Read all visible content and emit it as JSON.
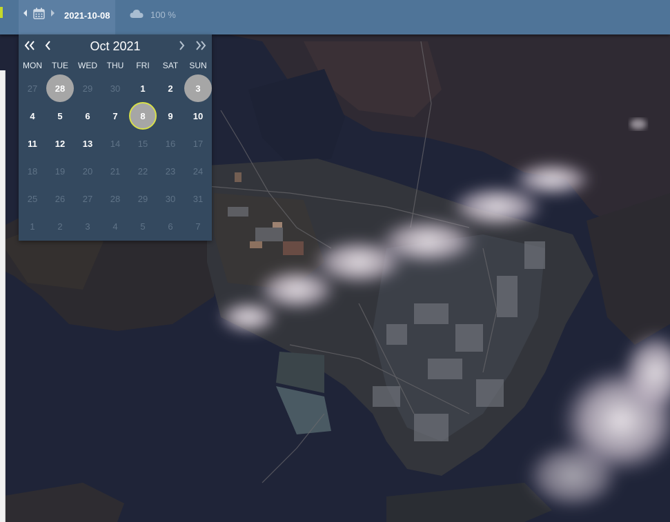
{
  "toolbar": {
    "prev_icon": "caret-left-icon",
    "calendar_icon": "calendar-icon",
    "next_icon": "caret-right-icon",
    "date": "2021-10-08",
    "cloud_icon": "cloud-icon",
    "cloud_coverage": "100 %"
  },
  "calendar": {
    "title": "Oct 2021",
    "nav": {
      "prev_year": "«",
      "prev_month": "‹",
      "next_month": "›",
      "next_year": "»"
    },
    "weekdays": [
      "MON",
      "TUE",
      "WED",
      "THU",
      "FRI",
      "SAT",
      "SUN"
    ],
    "weeks": [
      [
        {
          "d": "27",
          "s": "out"
        },
        {
          "d": "28",
          "s": "avail"
        },
        {
          "d": "29",
          "s": "out"
        },
        {
          "d": "30",
          "s": "out"
        },
        {
          "d": "1",
          "s": "in"
        },
        {
          "d": "2",
          "s": "in"
        },
        {
          "d": "3",
          "s": "avail"
        }
      ],
      [
        {
          "d": "4",
          "s": "in"
        },
        {
          "d": "5",
          "s": "in"
        },
        {
          "d": "6",
          "s": "in"
        },
        {
          "d": "7",
          "s": "in"
        },
        {
          "d": "8",
          "s": "selected"
        },
        {
          "d": "9",
          "s": "in"
        },
        {
          "d": "10",
          "s": "in"
        }
      ],
      [
        {
          "d": "11",
          "s": "in"
        },
        {
          "d": "12",
          "s": "in"
        },
        {
          "d": "13",
          "s": "in"
        },
        {
          "d": "14",
          "s": "dis"
        },
        {
          "d": "15",
          "s": "dis"
        },
        {
          "d": "16",
          "s": "dis"
        },
        {
          "d": "17",
          "s": "dis"
        }
      ],
      [
        {
          "d": "18",
          "s": "dis"
        },
        {
          "d": "19",
          "s": "dis"
        },
        {
          "d": "20",
          "s": "dis"
        },
        {
          "d": "21",
          "s": "dis"
        },
        {
          "d": "22",
          "s": "dis"
        },
        {
          "d": "23",
          "s": "dis"
        },
        {
          "d": "24",
          "s": "dis"
        }
      ],
      [
        {
          "d": "25",
          "s": "dis"
        },
        {
          "d": "26",
          "s": "dis"
        },
        {
          "d": "27",
          "s": "dis"
        },
        {
          "d": "28",
          "s": "dis"
        },
        {
          "d": "29",
          "s": "dis"
        },
        {
          "d": "30",
          "s": "dis"
        },
        {
          "d": "31",
          "s": "dis"
        }
      ],
      [
        {
          "d": "1",
          "s": "out"
        },
        {
          "d": "2",
          "s": "out"
        },
        {
          "d": "3",
          "s": "out"
        },
        {
          "d": "4",
          "s": "out"
        },
        {
          "d": "5",
          "s": "out"
        },
        {
          "d": "6",
          "s": "out"
        },
        {
          "d": "7",
          "s": "out"
        }
      ]
    ]
  },
  "colors": {
    "toolbar": "#4f7498",
    "calendar_bg": "#34495f",
    "available_day": "#a6a6a6",
    "selected_ring": "#d8e04a"
  }
}
